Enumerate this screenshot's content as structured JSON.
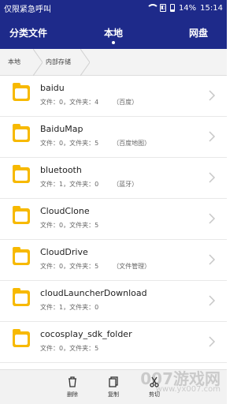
{
  "status_bar": {
    "left_text": "仅限紧急呼叫",
    "battery_percent": "14%",
    "time": "15:14"
  },
  "tabs": {
    "categories": "分类文件",
    "local": "本地",
    "network": "网盘"
  },
  "breadcrumb": {
    "root": "本地",
    "current": "内部存储"
  },
  "files": [
    {
      "name": "baidu",
      "meta": "文件：0，文件夹：4",
      "extra": "（百度）"
    },
    {
      "name": "BaiduMap",
      "meta": "文件：0，文件夹：5",
      "extra": "（百度地图）"
    },
    {
      "name": "bluetooth",
      "meta": "文件：1，文件夹：0",
      "extra": "（蓝牙）"
    },
    {
      "name": "CloudClone",
      "meta": "文件：0，文件夹：5",
      "extra": ""
    },
    {
      "name": "CloudDrive",
      "meta": "文件：0，文件夹：5",
      "extra": "（文件管理）"
    },
    {
      "name": "cloudLauncherDownload",
      "meta": "文件：1，文件夹：0",
      "extra": ""
    },
    {
      "name": "cocosplay_sdk_folder",
      "meta": "文件：0，文件夹：5",
      "extra": ""
    }
  ],
  "bottom_actions": {
    "delete": "删除",
    "copy": "复制",
    "move": "剪切"
  },
  "watermark": {
    "text": "007游戏网",
    "url": "www.yx007.com"
  }
}
